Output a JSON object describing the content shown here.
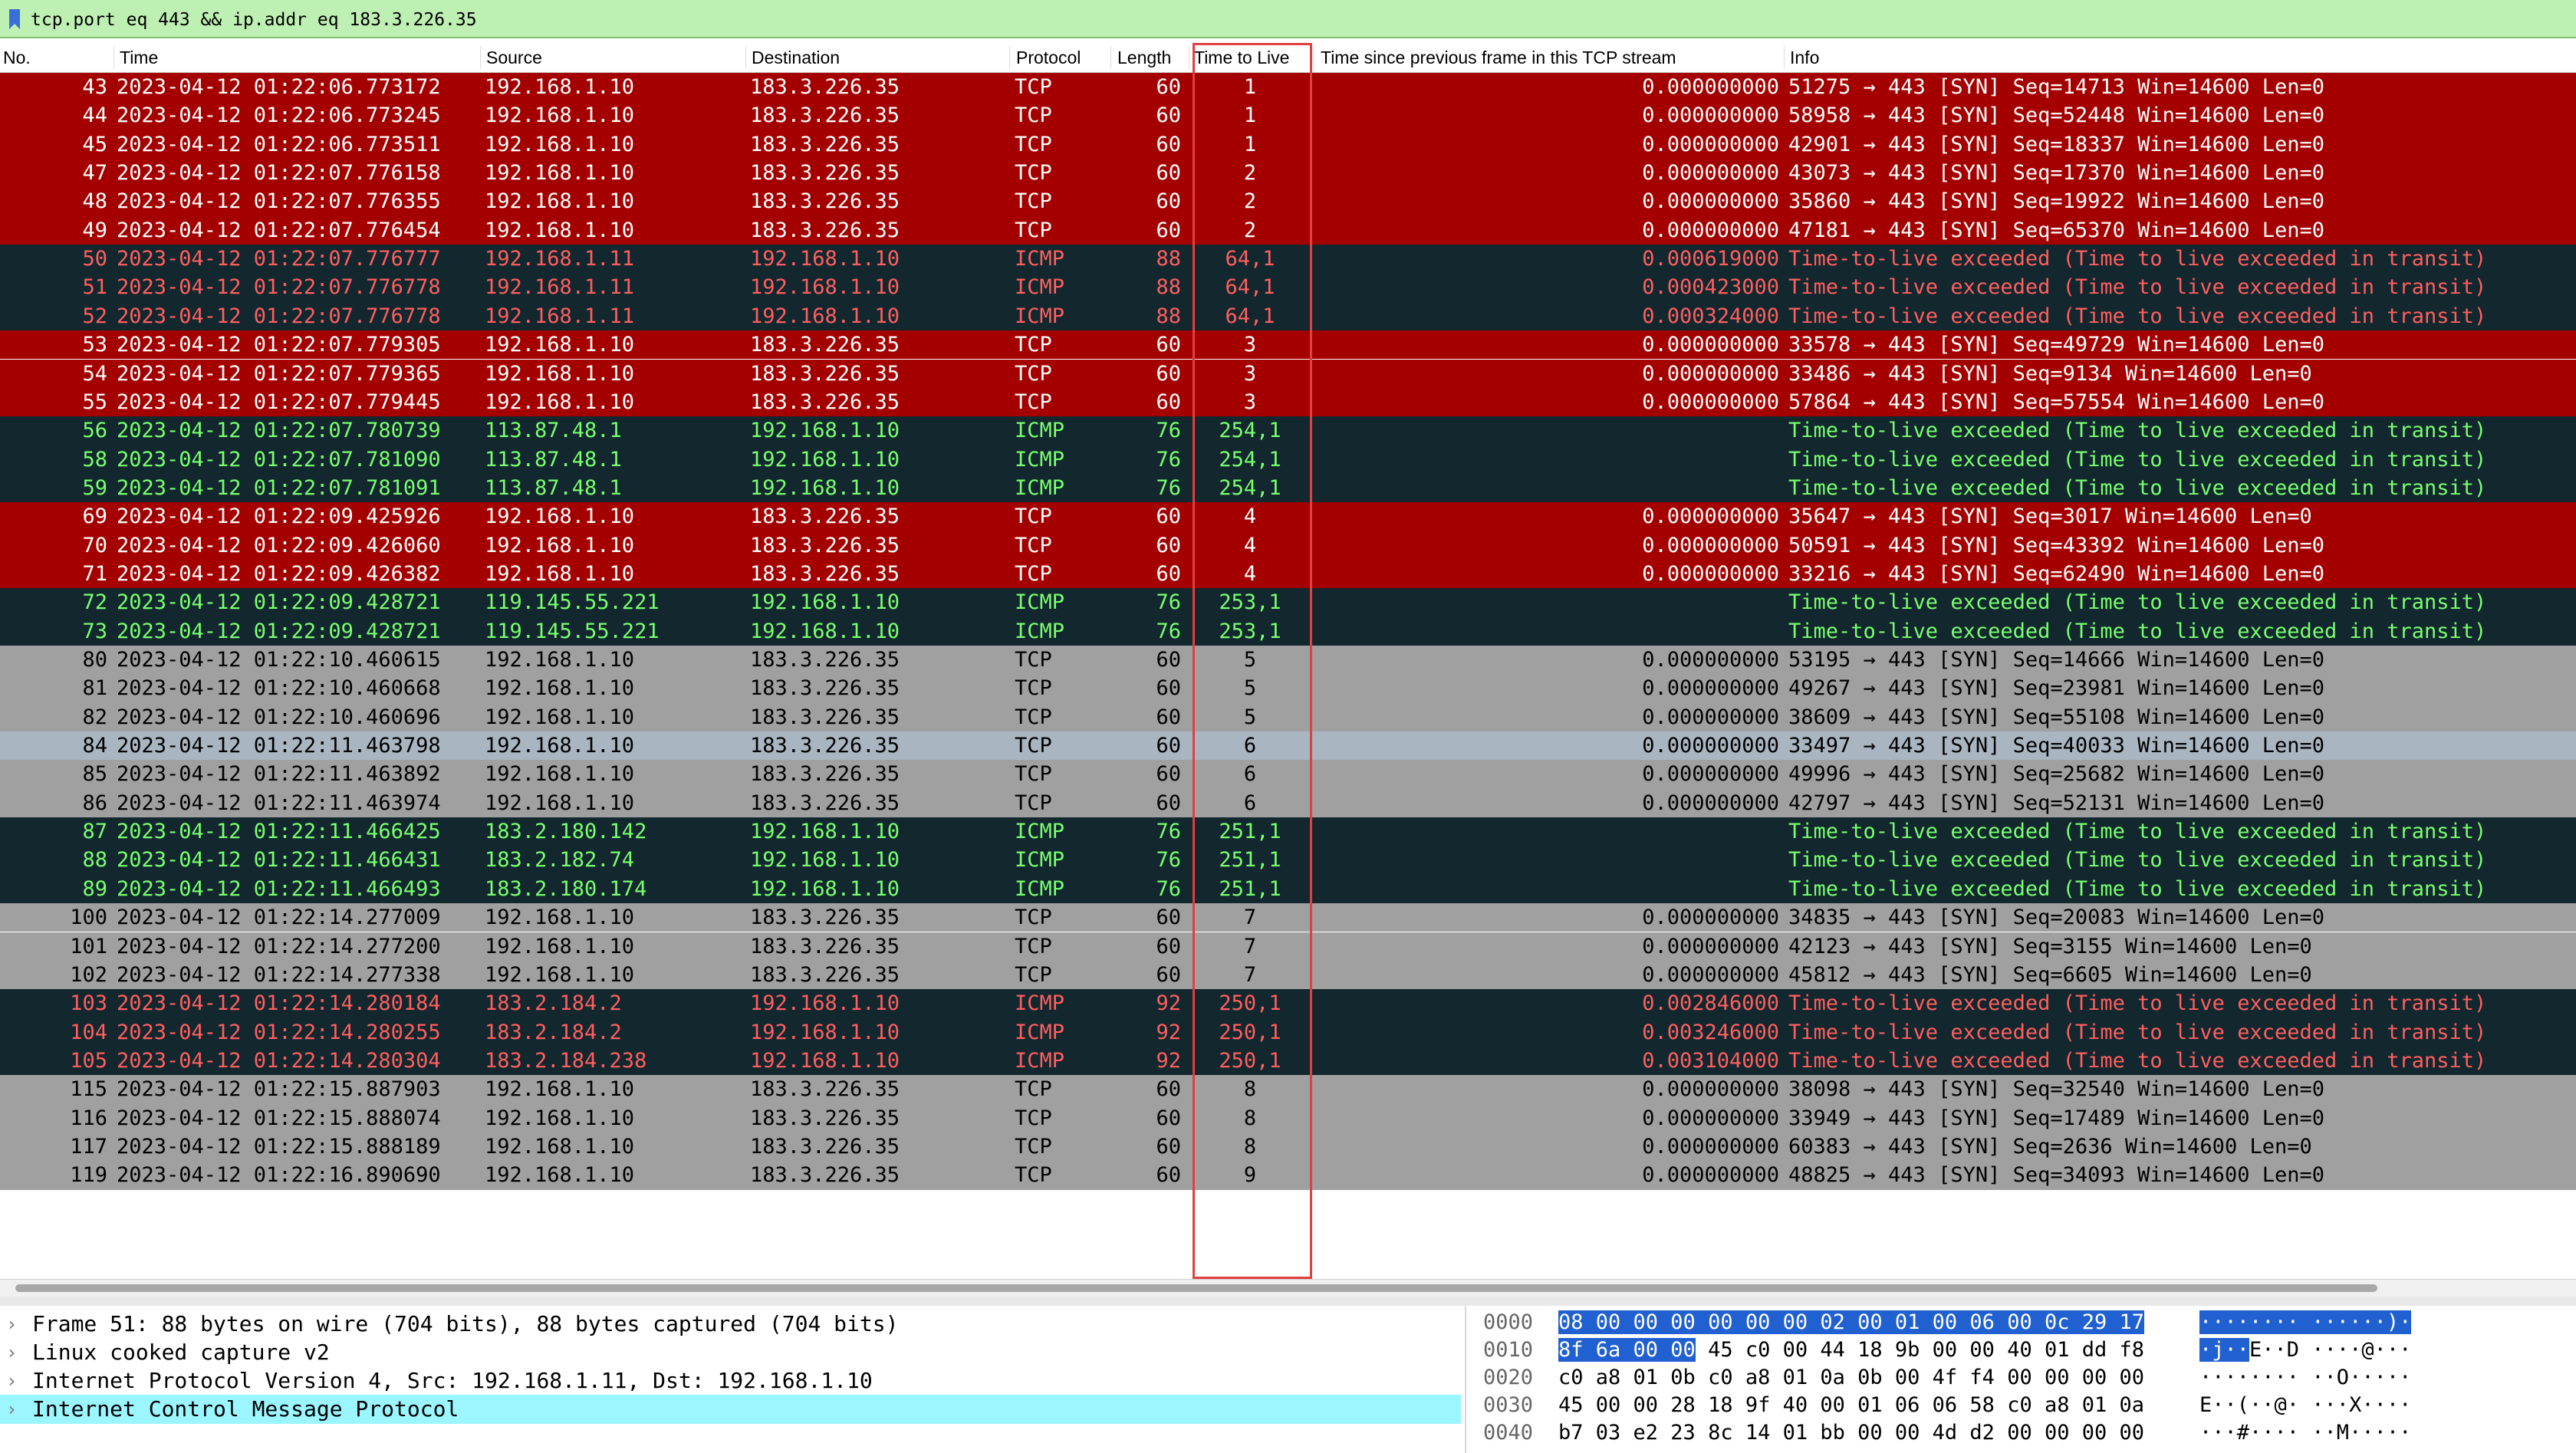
{
  "filter": {
    "value": "tcp.port eq 443 && ip.addr eq 183.3.226.35"
  },
  "columns": {
    "no": "No.",
    "time": "Time",
    "source": "Source",
    "destination": "Destination",
    "protocol": "Protocol",
    "length": "Length",
    "ttl": "Time to Live",
    "delta": "Time since previous frame in this TCP stream",
    "info": "Info"
  },
  "colors": {
    "tcp_red": "#a40000",
    "icmp_dark": "#12272e",
    "gray": "#a0a0a0",
    "selected_gray": "#a9b5c0",
    "icmp_text_green": "#78ff6e",
    "icmp_text_red": "#ff5f5f",
    "white": "#ffffff",
    "black": "#000000"
  },
  "rows": [
    {
      "no": "43",
      "time": "2023-04-12 01:22:06.773172",
      "src": "192.168.1.10",
      "dst": "183.3.226.35",
      "proto": "TCP",
      "len": "60",
      "ttl": "1",
      "delta": "0.000000000",
      "info": "51275 → 443 [SYN] Seq=14713 Win=14600 Len=0",
      "style": "tcp_red"
    },
    {
      "no": "44",
      "time": "2023-04-12 01:22:06.773245",
      "src": "192.168.1.10",
      "dst": "183.3.226.35",
      "proto": "TCP",
      "len": "60",
      "ttl": "1",
      "delta": "0.000000000",
      "info": "58958 → 443 [SYN] Seq=52448 Win=14600 Len=0",
      "style": "tcp_red"
    },
    {
      "no": "45",
      "time": "2023-04-12 01:22:06.773511",
      "src": "192.168.1.10",
      "dst": "183.3.226.35",
      "proto": "TCP",
      "len": "60",
      "ttl": "1",
      "delta": "0.000000000",
      "info": "42901 → 443 [SYN] Seq=18337 Win=14600 Len=0",
      "style": "tcp_red"
    },
    {
      "no": "47",
      "time": "2023-04-12 01:22:07.776158",
      "src": "192.168.1.10",
      "dst": "183.3.226.35",
      "proto": "TCP",
      "len": "60",
      "ttl": "2",
      "delta": "0.000000000",
      "info": "43073 → 443 [SYN] Seq=17370 Win=14600 Len=0",
      "style": "tcp_red"
    },
    {
      "no": "48",
      "time": "2023-04-12 01:22:07.776355",
      "src": "192.168.1.10",
      "dst": "183.3.226.35",
      "proto": "TCP",
      "len": "60",
      "ttl": "2",
      "delta": "0.000000000",
      "info": "35860 → 443 [SYN] Seq=19922 Win=14600 Len=0",
      "style": "tcp_red"
    },
    {
      "no": "49",
      "time": "2023-04-12 01:22:07.776454",
      "src": "192.168.1.10",
      "dst": "183.3.226.35",
      "proto": "TCP",
      "len": "60",
      "ttl": "2",
      "delta": "0.000000000",
      "info": "47181 → 443 [SYN] Seq=65370 Win=14600 Len=0",
      "style": "tcp_red"
    },
    {
      "no": "50",
      "time": "2023-04-12 01:22:07.776777",
      "src": "192.168.1.11",
      "dst": "192.168.1.10",
      "proto": "ICMP",
      "len": "88",
      "ttl": "64,1",
      "delta": "0.000619000",
      "info": "Time-to-live exceeded (Time to live exceeded in transit)",
      "style": "icmp_red"
    },
    {
      "no": "51",
      "time": "2023-04-12 01:22:07.776778",
      "src": "192.168.1.11",
      "dst": "192.168.1.10",
      "proto": "ICMP",
      "len": "88",
      "ttl": "64,1",
      "delta": "0.000423000",
      "info": "Time-to-live exceeded (Time to live exceeded in transit)",
      "style": "icmp_red"
    },
    {
      "no": "52",
      "time": "2023-04-12 01:22:07.776778",
      "src": "192.168.1.11",
      "dst": "192.168.1.10",
      "proto": "ICMP",
      "len": "88",
      "ttl": "64,1",
      "delta": "0.000324000",
      "info": "Time-to-live exceeded (Time to live exceeded in transit)",
      "style": "icmp_red"
    },
    {
      "no": "53",
      "time": "2023-04-12 01:22:07.779305",
      "src": "192.168.1.10",
      "dst": "183.3.226.35",
      "proto": "TCP",
      "len": "60",
      "ttl": "3",
      "delta": "0.000000000",
      "info": "33578 → 443 [SYN] Seq=49729 Win=14600 Len=0",
      "style": "tcp_red"
    },
    {
      "no": "54",
      "time": "2023-04-12 01:22:07.779365",
      "src": "192.168.1.10",
      "dst": "183.3.226.35",
      "proto": "TCP",
      "len": "60",
      "ttl": "3",
      "delta": "0.000000000",
      "info": "33486 → 443 [SYN] Seq=9134 Win=14600 Len=0",
      "style": "tcp_red"
    },
    {
      "no": "55",
      "time": "2023-04-12 01:22:07.779445",
      "src": "192.168.1.10",
      "dst": "183.3.226.35",
      "proto": "TCP",
      "len": "60",
      "ttl": "3",
      "delta": "0.000000000",
      "info": "57864 → 443 [SYN] Seq=57554 Win=14600 Len=0",
      "style": "tcp_red"
    },
    {
      "no": "56",
      "time": "2023-04-12 01:22:07.780739",
      "src": "113.87.48.1",
      "dst": "192.168.1.10",
      "proto": "ICMP",
      "len": "76",
      "ttl": "254,1",
      "delta": "",
      "info": "Time-to-live exceeded (Time to live exceeded in transit)",
      "style": "icmp_green"
    },
    {
      "no": "58",
      "time": "2023-04-12 01:22:07.781090",
      "src": "113.87.48.1",
      "dst": "192.168.1.10",
      "proto": "ICMP",
      "len": "76",
      "ttl": "254,1",
      "delta": "",
      "info": "Time-to-live exceeded (Time to live exceeded in transit)",
      "style": "icmp_green"
    },
    {
      "no": "59",
      "time": "2023-04-12 01:22:07.781091",
      "src": "113.87.48.1",
      "dst": "192.168.1.10",
      "proto": "ICMP",
      "len": "76",
      "ttl": "254,1",
      "delta": "",
      "info": "Time-to-live exceeded (Time to live exceeded in transit)",
      "style": "icmp_green"
    },
    {
      "no": "69",
      "time": "2023-04-12 01:22:09.425926",
      "src": "192.168.1.10",
      "dst": "183.3.226.35",
      "proto": "TCP",
      "len": "60",
      "ttl": "4",
      "delta": "0.000000000",
      "info": "35647 → 443 [SYN] Seq=3017 Win=14600 Len=0",
      "style": "tcp_red"
    },
    {
      "no": "70",
      "time": "2023-04-12 01:22:09.426060",
      "src": "192.168.1.10",
      "dst": "183.3.226.35",
      "proto": "TCP",
      "len": "60",
      "ttl": "4",
      "delta": "0.000000000",
      "info": "50591 → 443 [SYN] Seq=43392 Win=14600 Len=0",
      "style": "tcp_red"
    },
    {
      "no": "71",
      "time": "2023-04-12 01:22:09.426382",
      "src": "192.168.1.10",
      "dst": "183.3.226.35",
      "proto": "TCP",
      "len": "60",
      "ttl": "4",
      "delta": "0.000000000",
      "info": "33216 → 443 [SYN] Seq=62490 Win=14600 Len=0",
      "style": "tcp_red"
    },
    {
      "no": "72",
      "time": "2023-04-12 01:22:09.428721",
      "src": "119.145.55.221",
      "dst": "192.168.1.10",
      "proto": "ICMP",
      "len": "76",
      "ttl": "253,1",
      "delta": "",
      "info": "Time-to-live exceeded (Time to live exceeded in transit)",
      "style": "icmp_green"
    },
    {
      "no": "73",
      "time": "2023-04-12 01:22:09.428721",
      "src": "119.145.55.221",
      "dst": "192.168.1.10",
      "proto": "ICMP",
      "len": "76",
      "ttl": "253,1",
      "delta": "",
      "info": "Time-to-live exceeded (Time to live exceeded in transit)",
      "style": "icmp_green"
    },
    {
      "no": "80",
      "time": "2023-04-12 01:22:10.460615",
      "src": "192.168.1.10",
      "dst": "183.3.226.35",
      "proto": "TCP",
      "len": "60",
      "ttl": "5",
      "delta": "0.000000000",
      "info": "53195 → 443 [SYN] Seq=14666 Win=14600 Len=0",
      "style": "gray"
    },
    {
      "no": "81",
      "time": "2023-04-12 01:22:10.460668",
      "src": "192.168.1.10",
      "dst": "183.3.226.35",
      "proto": "TCP",
      "len": "60",
      "ttl": "5",
      "delta": "0.000000000",
      "info": "49267 → 443 [SYN] Seq=23981 Win=14600 Len=0",
      "style": "gray"
    },
    {
      "no": "82",
      "time": "2023-04-12 01:22:10.460696",
      "src": "192.168.1.10",
      "dst": "183.3.226.35",
      "proto": "TCP",
      "len": "60",
      "ttl": "5",
      "delta": "0.000000000",
      "info": "38609 → 443 [SYN] Seq=55108 Win=14600 Len=0",
      "style": "gray"
    },
    {
      "no": "84",
      "time": "2023-04-12 01:22:11.463798",
      "src": "192.168.1.10",
      "dst": "183.3.226.35",
      "proto": "TCP",
      "len": "60",
      "ttl": "6",
      "delta": "0.000000000",
      "info": "33497 → 443 [SYN] Seq=40033 Win=14600 Len=0",
      "style": "selected_gray"
    },
    {
      "no": "85",
      "time": "2023-04-12 01:22:11.463892",
      "src": "192.168.1.10",
      "dst": "183.3.226.35",
      "proto": "TCP",
      "len": "60",
      "ttl": "6",
      "delta": "0.000000000",
      "info": "49996 → 443 [SYN] Seq=25682 Win=14600 Len=0",
      "style": "gray"
    },
    {
      "no": "86",
      "time": "2023-04-12 01:22:11.463974",
      "src": "192.168.1.10",
      "dst": "183.3.226.35",
      "proto": "TCP",
      "len": "60",
      "ttl": "6",
      "delta": "0.000000000",
      "info": "42797 → 443 [SYN] Seq=52131 Win=14600 Len=0",
      "style": "gray"
    },
    {
      "no": "87",
      "time": "2023-04-12 01:22:11.466425",
      "src": "183.2.180.142",
      "dst": "192.168.1.10",
      "proto": "ICMP",
      "len": "76",
      "ttl": "251,1",
      "delta": "",
      "info": "Time-to-live exceeded (Time to live exceeded in transit)",
      "style": "icmp_green"
    },
    {
      "no": "88",
      "time": "2023-04-12 01:22:11.466431",
      "src": "183.2.182.74",
      "dst": "192.168.1.10",
      "proto": "ICMP",
      "len": "76",
      "ttl": "251,1",
      "delta": "",
      "info": "Time-to-live exceeded (Time to live exceeded in transit)",
      "style": "icmp_green"
    },
    {
      "no": "89",
      "time": "2023-04-12 01:22:11.466493",
      "src": "183.2.180.174",
      "dst": "192.168.1.10",
      "proto": "ICMP",
      "len": "76",
      "ttl": "251,1",
      "delta": "",
      "info": "Time-to-live exceeded (Time to live exceeded in transit)",
      "style": "icmp_green"
    },
    {
      "no": "100",
      "time": "2023-04-12 01:22:14.277009",
      "src": "192.168.1.10",
      "dst": "183.3.226.35",
      "proto": "TCP",
      "len": "60",
      "ttl": "7",
      "delta": "0.000000000",
      "info": "34835 → 443 [SYN] Seq=20083 Win=14600 Len=0",
      "style": "gray"
    },
    {
      "no": "101",
      "time": "2023-04-12 01:22:14.277200",
      "src": "192.168.1.10",
      "dst": "183.3.226.35",
      "proto": "TCP",
      "len": "60",
      "ttl": "7",
      "delta": "0.000000000",
      "info": "42123 → 443 [SYN] Seq=3155 Win=14600 Len=0",
      "style": "gray"
    },
    {
      "no": "102",
      "time": "2023-04-12 01:22:14.277338",
      "src": "192.168.1.10",
      "dst": "183.3.226.35",
      "proto": "TCP",
      "len": "60",
      "ttl": "7",
      "delta": "0.000000000",
      "info": "45812 → 443 [SYN] Seq=6605 Win=14600 Len=0",
      "style": "gray"
    },
    {
      "no": "103",
      "time": "2023-04-12 01:22:14.280184",
      "src": "183.2.184.2",
      "dst": "192.168.1.10",
      "proto": "ICMP",
      "len": "92",
      "ttl": "250,1",
      "delta": "0.002846000",
      "info": "Time-to-live exceeded (Time to live exceeded in transit)",
      "style": "icmp_red"
    },
    {
      "no": "104",
      "time": "2023-04-12 01:22:14.280255",
      "src": "183.2.184.2",
      "dst": "192.168.1.10",
      "proto": "ICMP",
      "len": "92",
      "ttl": "250,1",
      "delta": "0.003246000",
      "info": "Time-to-live exceeded (Time to live exceeded in transit)",
      "style": "icmp_red"
    },
    {
      "no": "105",
      "time": "2023-04-12 01:22:14.280304",
      "src": "183.2.184.238",
      "dst": "192.168.1.10",
      "proto": "ICMP",
      "len": "92",
      "ttl": "250,1",
      "delta": "0.003104000",
      "info": "Time-to-live exceeded (Time to live exceeded in transit)",
      "style": "icmp_red"
    },
    {
      "no": "115",
      "time": "2023-04-12 01:22:15.887903",
      "src": "192.168.1.10",
      "dst": "183.3.226.35",
      "proto": "TCP",
      "len": "60",
      "ttl": "8",
      "delta": "0.000000000",
      "info": "38098 → 443 [SYN] Seq=32540 Win=14600 Len=0",
      "style": "gray"
    },
    {
      "no": "116",
      "time": "2023-04-12 01:22:15.888074",
      "src": "192.168.1.10",
      "dst": "183.3.226.35",
      "proto": "TCP",
      "len": "60",
      "ttl": "8",
      "delta": "0.000000000",
      "info": "33949 → 443 [SYN] Seq=17489 Win=14600 Len=0",
      "style": "gray"
    },
    {
      "no": "117",
      "time": "2023-04-12 01:22:15.888189",
      "src": "192.168.1.10",
      "dst": "183.3.226.35",
      "proto": "TCP",
      "len": "60",
      "ttl": "8",
      "delta": "0.000000000",
      "info": "60383 → 443 [SYN] Seq=2636 Win=14600 Len=0",
      "style": "gray"
    },
    {
      "no": "119",
      "time": "2023-04-12 01:22:16.890690",
      "src": "192.168.1.10",
      "dst": "183.3.226.35",
      "proto": "TCP",
      "len": "60",
      "ttl": "9",
      "delta": "0.000000000",
      "info": "48825 → 443 [SYN] Seq=34093 Win=14600 Len=0",
      "style": "gray"
    }
  ],
  "details": [
    {
      "text": "Frame 51: 88 bytes on wire (704 bits), 88 bytes captured (704 bits)",
      "selected": false
    },
    {
      "text": "Linux cooked capture v2",
      "selected": false
    },
    {
      "text": "Internet Protocol Version 4, Src: 192.168.1.11, Dst: 192.168.1.10",
      "selected": false
    },
    {
      "text": "Internet Control Message Protocol",
      "selected": true
    }
  ],
  "bytes": [
    {
      "offset": "0000",
      "hex_hl": "08 00 00 00 00 00 00 02  00 01 00 06 00 0c 29 17",
      "hex": "",
      "ascii_hl": "········ ······)·",
      "ascii": ""
    },
    {
      "offset": "0010",
      "hex_hl": "8f 6a 00 00",
      "hex": " 45 c0 00 44  18 9b 00 00 40 01 dd f8",
      "ascii_hl": "·j··",
      "ascii": "E··D ····@···"
    },
    {
      "offset": "0020",
      "hex_hl": "",
      "hex": "c0 a8 01 0b c0 a8 01 0a  0b 00 4f f4 00 00 00 00",
      "ascii_hl": "",
      "ascii": "········ ··O·····"
    },
    {
      "offset": "0030",
      "hex_hl": "",
      "hex": "45 00 00 28 18 9f 40 00  01 06 06 58 c0 a8 01 0a",
      "ascii_hl": "",
      "ascii": "E··(··@· ···X····"
    },
    {
      "offset": "0040",
      "hex_hl": "",
      "hex": "b7 03 e2 23 8c 14 01 bb  00 00 4d d2 00 00 00 00",
      "ascii_hl": "",
      "ascii": "···#···· ··M·····"
    }
  ]
}
